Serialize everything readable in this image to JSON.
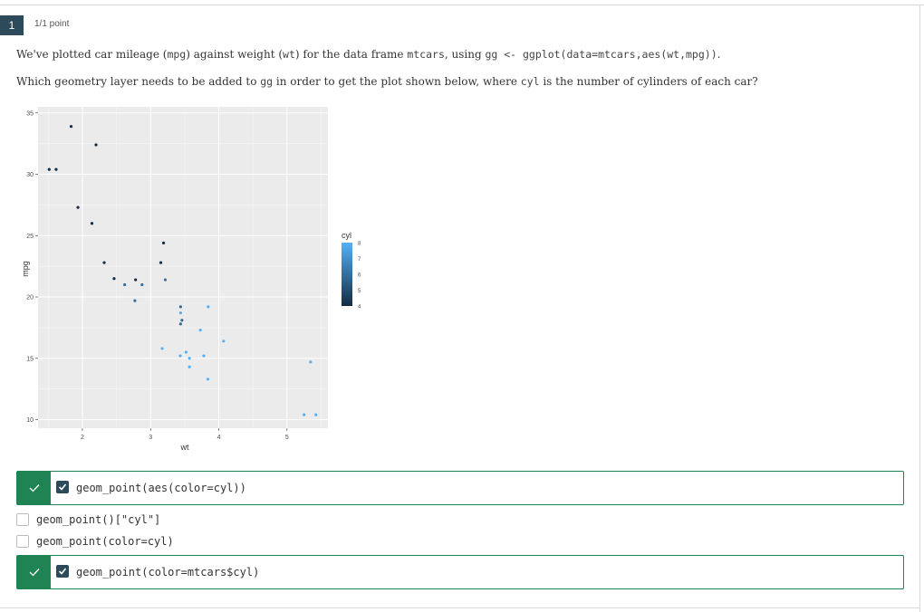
{
  "question": {
    "number": "1",
    "points": "1/1 point",
    "line1_parts": [
      "We've plotted car mileage (",
      "mpg",
      ") against weight (",
      "wt",
      ") for the data frame ",
      "mtcars",
      ", using ",
      "gg <- ggplot(data=mtcars,aes(wt,mpg))",
      "."
    ],
    "line2_parts": [
      "Which geometry layer needs to be added to ",
      "gg",
      " in order to get the plot shown below, where ",
      "cyl",
      " is the number of cylinders of each car?"
    ]
  },
  "chart_data": {
    "type": "scatter",
    "xlabel": "wt",
    "ylabel": "mpg",
    "xlim": [
      1.35,
      5.6
    ],
    "ylim": [
      9.3,
      35.5
    ],
    "xticks": [
      2,
      3,
      4,
      5
    ],
    "yticks": [
      10,
      15,
      20,
      25,
      30,
      35
    ],
    "grid": true,
    "legend": {
      "title": "cyl",
      "position": "right",
      "type": "colorbar",
      "labels": [
        "8",
        "7",
        "6",
        "5",
        "4"
      ],
      "low_color": "#132B43",
      "high_color": "#56B1F7",
      "range": [
        4,
        8
      ]
    },
    "points": [
      {
        "x": 2.62,
        "y": 21.0,
        "cyl": 6
      },
      {
        "x": 2.875,
        "y": 21.0,
        "cyl": 6
      },
      {
        "x": 2.32,
        "y": 22.8,
        "cyl": 4
      },
      {
        "x": 3.215,
        "y": 21.4,
        "cyl": 6
      },
      {
        "x": 3.44,
        "y": 18.7,
        "cyl": 8
      },
      {
        "x": 3.46,
        "y": 18.1,
        "cyl": 6
      },
      {
        "x": 3.57,
        "y": 14.3,
        "cyl": 8
      },
      {
        "x": 3.19,
        "y": 24.4,
        "cyl": 4
      },
      {
        "x": 3.15,
        "y": 22.8,
        "cyl": 4
      },
      {
        "x": 3.44,
        "y": 19.2,
        "cyl": 6
      },
      {
        "x": 3.44,
        "y": 17.8,
        "cyl": 6
      },
      {
        "x": 4.07,
        "y": 16.4,
        "cyl": 8
      },
      {
        "x": 3.73,
        "y": 17.3,
        "cyl": 8
      },
      {
        "x": 3.78,
        "y": 15.2,
        "cyl": 8
      },
      {
        "x": 5.25,
        "y": 10.4,
        "cyl": 8
      },
      {
        "x": 5.424,
        "y": 10.4,
        "cyl": 8
      },
      {
        "x": 5.345,
        "y": 14.7,
        "cyl": 8
      },
      {
        "x": 2.2,
        "y": 32.4,
        "cyl": 4
      },
      {
        "x": 1.615,
        "y": 30.4,
        "cyl": 4
      },
      {
        "x": 1.835,
        "y": 33.9,
        "cyl": 4
      },
      {
        "x": 2.465,
        "y": 21.5,
        "cyl": 4
      },
      {
        "x": 3.52,
        "y": 15.5,
        "cyl": 8
      },
      {
        "x": 3.435,
        "y": 15.2,
        "cyl": 8
      },
      {
        "x": 3.84,
        "y": 13.3,
        "cyl": 8
      },
      {
        "x": 3.845,
        "y": 19.2,
        "cyl": 8
      },
      {
        "x": 1.935,
        "y": 27.3,
        "cyl": 4
      },
      {
        "x": 2.14,
        "y": 26.0,
        "cyl": 4
      },
      {
        "x": 1.513,
        "y": 30.4,
        "cyl": 4
      },
      {
        "x": 3.17,
        "y": 15.8,
        "cyl": 8
      },
      {
        "x": 2.77,
        "y": 19.7,
        "cyl": 6
      },
      {
        "x": 3.57,
        "y": 15.0,
        "cyl": 8
      },
      {
        "x": 2.78,
        "y": 21.4,
        "cyl": 4
      }
    ]
  },
  "options": [
    {
      "label": "geom_point(aes(color=cyl))",
      "checked": true,
      "correct": true
    },
    {
      "label": "geom_point()[\"cyl\"]",
      "checked": false
    },
    {
      "label": "geom_point(color=cyl)",
      "checked": false
    },
    {
      "label": "geom_point(color=mtcars$cyl)",
      "checked": true,
      "correct": true
    }
  ],
  "colors": {
    "correct_green": "#1f8354",
    "dark_badge": "#2d4a5a"
  }
}
